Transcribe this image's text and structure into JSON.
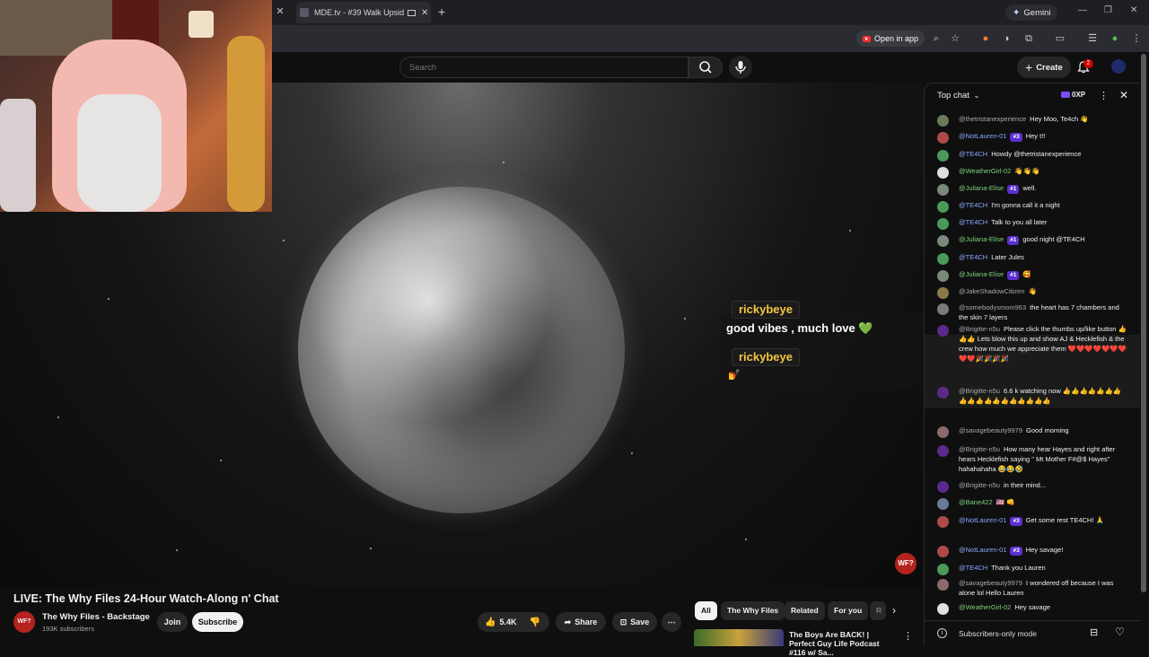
{
  "browser": {
    "active_tab_title": "MDE.tv - #39 Walk Upside D",
    "new_tab_symbol": "+",
    "gemini_label": "Gemini",
    "open_in_app_label": "Open in app"
  },
  "youtube": {
    "search_placeholder": "Search",
    "create_label": "Create",
    "notification_count": "2"
  },
  "video": {
    "title": "LIVE: The Why Files 24-Hour Watch-Along n' Chat",
    "logo_text": "WF?",
    "overlay": [
      {
        "name": "rickybeye",
        "message": "good vibes , much love 💚"
      },
      {
        "name": "rickybeye",
        "message": "💅"
      }
    ]
  },
  "channel": {
    "avatar_text": "WF?",
    "name": "The Why Files - Backstage",
    "subscribers": "193K subscribers",
    "join_label": "Join",
    "subscribe_label": "Subscribe"
  },
  "actions": {
    "like_count": "5.4K",
    "share_label": "Share",
    "save_label": "Save"
  },
  "chips": [
    "All",
    "The Why Files",
    "Related",
    "For you",
    "R"
  ],
  "recommendation": {
    "title": "The Boys Are BACK! | Perfect Guy Life Podcast #116 w/ Sa..."
  },
  "chat": {
    "mode": "Top chat",
    "xp": "0XP",
    "input_label": "Subscribers-only mode",
    "messages": [
      {
        "author": "@thetristanexperience",
        "text": "Hey Moo, Te4ch 👋",
        "color": "#6a7a5a",
        "style": "gray"
      },
      {
        "author": "@NotLauren-01",
        "badge": "#3",
        "text": "Hey t!!",
        "color": "#b04a4a",
        "style": "blue"
      },
      {
        "author": "@TE4CH",
        "text": "Howdy @thetristanexperience",
        "color": "#4a9a5a",
        "style": "blue"
      },
      {
        "author": "@WeatherGirl-02",
        "text": "👋👋👋",
        "color": "#e0e0e0",
        "style": "green"
      },
      {
        "author": "@Juliana-Elise",
        "badge": "#1",
        "text": "well.",
        "color": "#7a8a7a",
        "style": "green"
      },
      {
        "author": "@TE4CH",
        "text": "I'm gonna call it a night",
        "color": "#4a9a5a",
        "style": "blue"
      },
      {
        "author": "@TE4CH",
        "text": "Talk to you all later",
        "color": "#4a9a5a",
        "style": "blue"
      },
      {
        "author": "@Juliana-Elise",
        "badge": "#1",
        "text": "good night @TE4CH",
        "color": "#7a8a7a",
        "style": "green"
      },
      {
        "author": "@TE4CH",
        "text": "Later Jules",
        "color": "#4a9a5a",
        "style": "blue"
      },
      {
        "author": "@Juliana-Elise",
        "badge": "#1",
        "text": "🥰",
        "color": "#7a8a7a",
        "style": "green"
      },
      {
        "author": "@JakeShadowCitizen",
        "text": "👋",
        "color": "#8a7a4a",
        "style": "gray"
      },
      {
        "author": "@somebodysmom963",
        "text": "the heart has 7 chambers and the skin 7 layers",
        "color": "#7a7a7a",
        "style": "gray"
      },
      {
        "author": "@Brigitte-n5u",
        "text": "Please click the thumbs up/like button 👍👍👍 Lets blow this up and show AJ & Hecklefish & the crew how much we appreciate them ❤️❤️❤️❤️❤️❤️❤️❤️❤️🎉🎉🎉🎉",
        "color": "#5a2a8a",
        "style": "gray"
      },
      {
        "author": "@Brigitte-n5u",
        "text": "6.6 k watching now 👍👍👍👍👍👍👍👍👍👍👍👍👍👍👍👍👍👍",
        "color": "#5a2a8a",
        "style": "gray"
      },
      {
        "author": "@savagebeauty9979",
        "text": "Good morning",
        "color": "#8a6a6a",
        "style": "gray"
      },
      {
        "author": "@Brigitte-n5u",
        "text": "How many hear Hayes and right after hears Hecklefish saying \" Mt Mother F#@$ Hayes\" hahahahaha 😂😂🤣",
        "color": "#5a2a8a",
        "style": "gray"
      },
      {
        "author": "@Brigitte-n5u",
        "text": "in their mind...",
        "color": "#5a2a8a",
        "style": "gray"
      },
      {
        "author": "@Bane422",
        "text": "🇺🇸 👊",
        "color": "#6a7a9a",
        "style": "green"
      },
      {
        "author": "@NotLauren-01",
        "badge": "#3",
        "text": "Get some rest TE4CH! 🙏",
        "color": "#b04a4a",
        "style": "blue"
      },
      {
        "author": "@NotLauren-01",
        "badge": "#3",
        "text": "Hey savage!",
        "color": "#b04a4a",
        "style": "blue"
      },
      {
        "author": "@TE4CH",
        "text": "Thank you Lauren",
        "color": "#4a9a5a",
        "style": "blue"
      },
      {
        "author": "@savagebeauty9979",
        "text": "I wondered off because I was alone lol Hello Lauren",
        "color": "#8a6a6a",
        "style": "gray"
      },
      {
        "author": "@WeatherGirl-02",
        "text": "Hey savage",
        "color": "#e0e0e0",
        "style": "green"
      }
    ]
  }
}
